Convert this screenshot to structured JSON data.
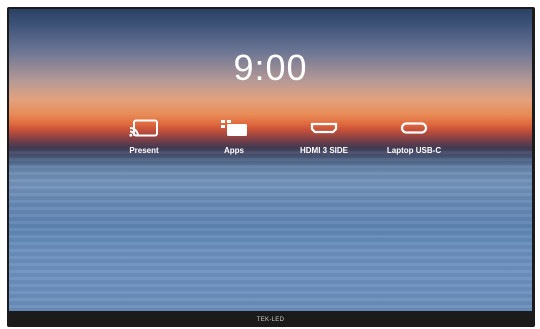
{
  "screen": {
    "time": "9:00"
  },
  "sources": [
    {
      "label": "Present",
      "icon": "cast-icon"
    },
    {
      "label": "Apps",
      "icon": "apps-icon"
    },
    {
      "label": "HDMI 3 SIDE",
      "icon": "hdmi-icon"
    },
    {
      "label": "Laptop USB-C",
      "icon": "usb-c-icon"
    }
  ],
  "footer": {
    "brand": "TEK-LED"
  },
  "colors": {
    "text": "#ffffff",
    "bezel": "#1b1b1b",
    "sky_top": "#2a4163",
    "sunset": "#e88b56",
    "water": "#6886ad"
  }
}
